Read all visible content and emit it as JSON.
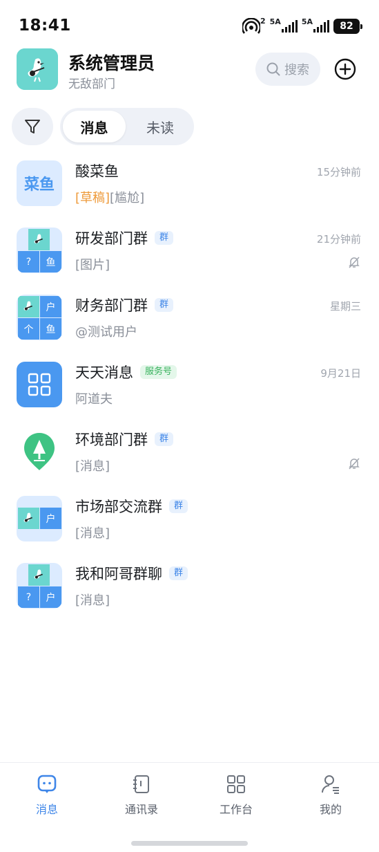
{
  "status_bar": {
    "time": "18:41",
    "hotspot_count": "2",
    "sim1_label": "5A",
    "sim2_label": "5A",
    "battery": "82"
  },
  "header": {
    "title": "系统管理员",
    "subtitle": "无敌部门",
    "search_label": "搜索",
    "icons": [
      "search-icon",
      "add-circle-icon"
    ]
  },
  "filter": {
    "tabs": [
      "消息",
      "未读"
    ],
    "active_tab": "消息",
    "icon": "filter-funnel-icon"
  },
  "colors": {
    "accent": "#3f86e8",
    "draft": "#ee9a3a",
    "service_tag": "#38b25d",
    "avatar_teal": "#6bd6cf",
    "avatar_blue": "#4a98f0"
  },
  "conversations": [
    {
      "name": "酸菜鱼",
      "avatar_text": "菜鱼",
      "draft_label": "[草稿]",
      "preview": "[尴尬]",
      "time": "15分钟前",
      "tag": "",
      "muted": false
    },
    {
      "name": "研发部门群",
      "tag": "群",
      "preview": "[图片]",
      "time": "21分钟前",
      "muted": true,
      "avatar_cells": [
        "?",
        "鱼"
      ]
    },
    {
      "name": "财务部门群",
      "tag": "群",
      "preview": "@测试用户",
      "time": "星期三",
      "muted": false,
      "avatar_cells": [
        "户",
        "个",
        "鱼"
      ]
    },
    {
      "name": "天天消息",
      "tag": "服务号",
      "preview": "阿道夫",
      "time": "9月21日",
      "muted": false
    },
    {
      "name": "环境部门群",
      "tag": "群",
      "preview": "[消息]",
      "time": "",
      "muted": true
    },
    {
      "name": "市场部交流群",
      "tag": "群",
      "preview": "[消息]",
      "time": "",
      "muted": false,
      "avatar_cells": [
        "户"
      ]
    },
    {
      "name": "我和阿哥群聊",
      "tag": "群",
      "preview": "[消息]",
      "time": "",
      "muted": false,
      "avatar_cells": [
        "?",
        "户"
      ]
    }
  ],
  "bottom_nav": [
    {
      "label": "消息",
      "icon": "chat-bubble-icon",
      "active": true
    },
    {
      "label": "通讯录",
      "icon": "contacts-book-icon",
      "active": false
    },
    {
      "label": "工作台",
      "icon": "grid-apps-icon",
      "active": false
    },
    {
      "label": "我的",
      "icon": "profile-icon",
      "active": false
    }
  ]
}
